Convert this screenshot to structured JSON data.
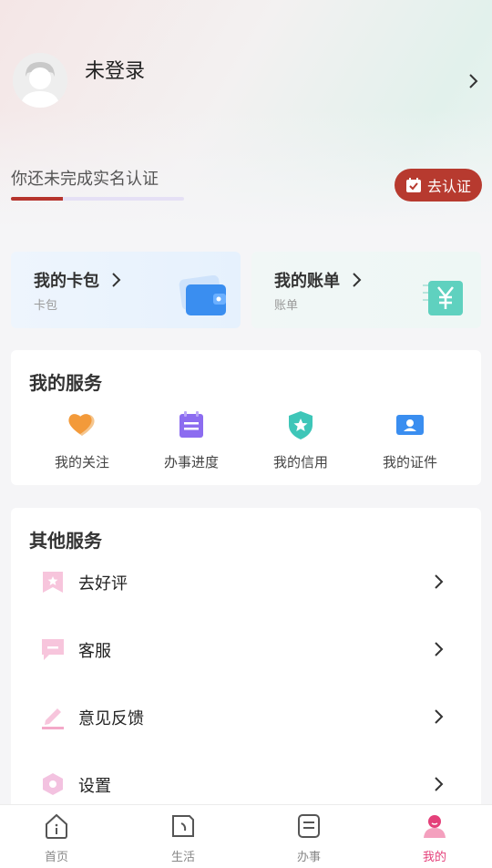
{
  "profile": {
    "name": "未登录"
  },
  "auth": {
    "prompt": "你还未完成实名认证",
    "button_label": "去认证",
    "progress": 0.3
  },
  "cards": [
    {
      "title": "我的卡包",
      "subtitle": "卡包",
      "icon": "wallet-icon"
    },
    {
      "title": "我的账单",
      "subtitle": "账单",
      "icon": "yuan-bill-icon"
    }
  ],
  "my_services": {
    "title": "我的服务",
    "items": [
      {
        "label": "我的关注",
        "icon": "heart-icon"
      },
      {
        "label": "办事进度",
        "icon": "calendar-icon"
      },
      {
        "label": "我的信用",
        "icon": "shield-star-icon"
      },
      {
        "label": "我的证件",
        "icon": "id-card-icon"
      }
    ]
  },
  "other_services": {
    "title": "其他服务",
    "items": [
      {
        "label": "去好评",
        "icon": "bookmark-star-icon"
      },
      {
        "label": "客服",
        "icon": "chat-icon"
      },
      {
        "label": "意见反馈",
        "icon": "pencil-icon"
      },
      {
        "label": "设置",
        "icon": "hexagon-gear-icon"
      }
    ]
  },
  "tabs": [
    {
      "label": "首页",
      "icon": "home-icon"
    },
    {
      "label": "生活",
      "icon": "life-icon"
    },
    {
      "label": "办事",
      "icon": "document-icon"
    },
    {
      "label": "我的",
      "icon": "user-icon",
      "active": true
    }
  ],
  "colors": {
    "accent_red": "#b73a2f",
    "tab_active": "#e4407a"
  }
}
